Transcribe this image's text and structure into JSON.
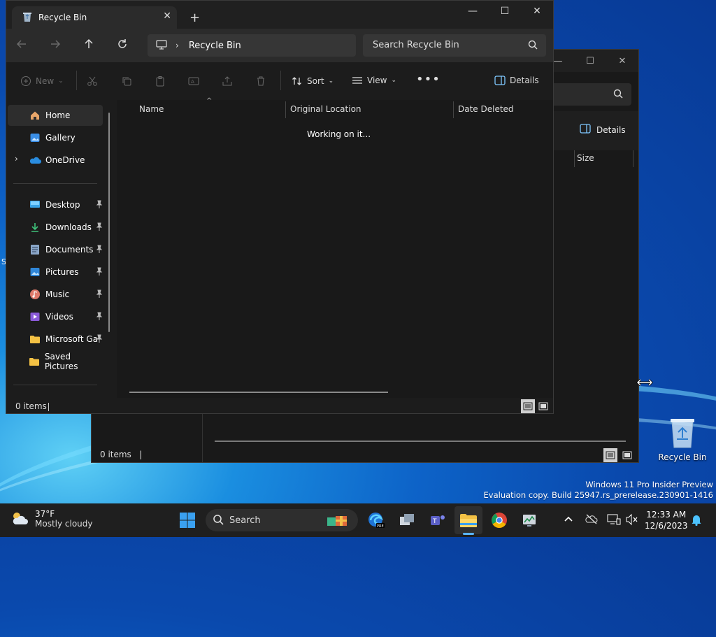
{
  "front_window": {
    "tab_title": "Recycle Bin",
    "address": "Recycle Bin",
    "search_placeholder": "Search Recycle Bin",
    "toolbar": {
      "new_label": "New",
      "sort_label": "Sort",
      "view_label": "View",
      "details_label": "Details"
    },
    "nav": {
      "home": "Home",
      "gallery": "Gallery",
      "onedrive": "OneDrive",
      "desktop": "Desktop",
      "downloads": "Downloads",
      "documents": "Documents",
      "pictures": "Pictures",
      "music": "Music",
      "videos": "Videos",
      "microsoft_ga": "Microsoft Ga",
      "saved_pictures": "Saved Pictures"
    },
    "columns": {
      "name": "Name",
      "original_location": "Original Location",
      "date_deleted": "Date Deleted"
    },
    "loading_text": "Working on it...",
    "status": "0 items"
  },
  "back_window": {
    "details_label": "Details",
    "size_column": "Size",
    "status": "0 items"
  },
  "desktop": {
    "recycle_bin_label": "Recycle Bin",
    "watermark_line1": "Windows 11 Pro Insider Preview",
    "watermark_line2": "Evaluation copy. Build 25947.rs_prerelease.230901-1416"
  },
  "taskbar": {
    "weather_temp": "37°F",
    "weather_desc": "Mostly cloudy",
    "search_label": "Search",
    "time": "12:33 AM",
    "date": "12/6/2023"
  },
  "colors": {
    "accent": "#4cc2ff",
    "window_bg": "#1c1c1c",
    "taskbar_bg": "#1f1f1f"
  }
}
